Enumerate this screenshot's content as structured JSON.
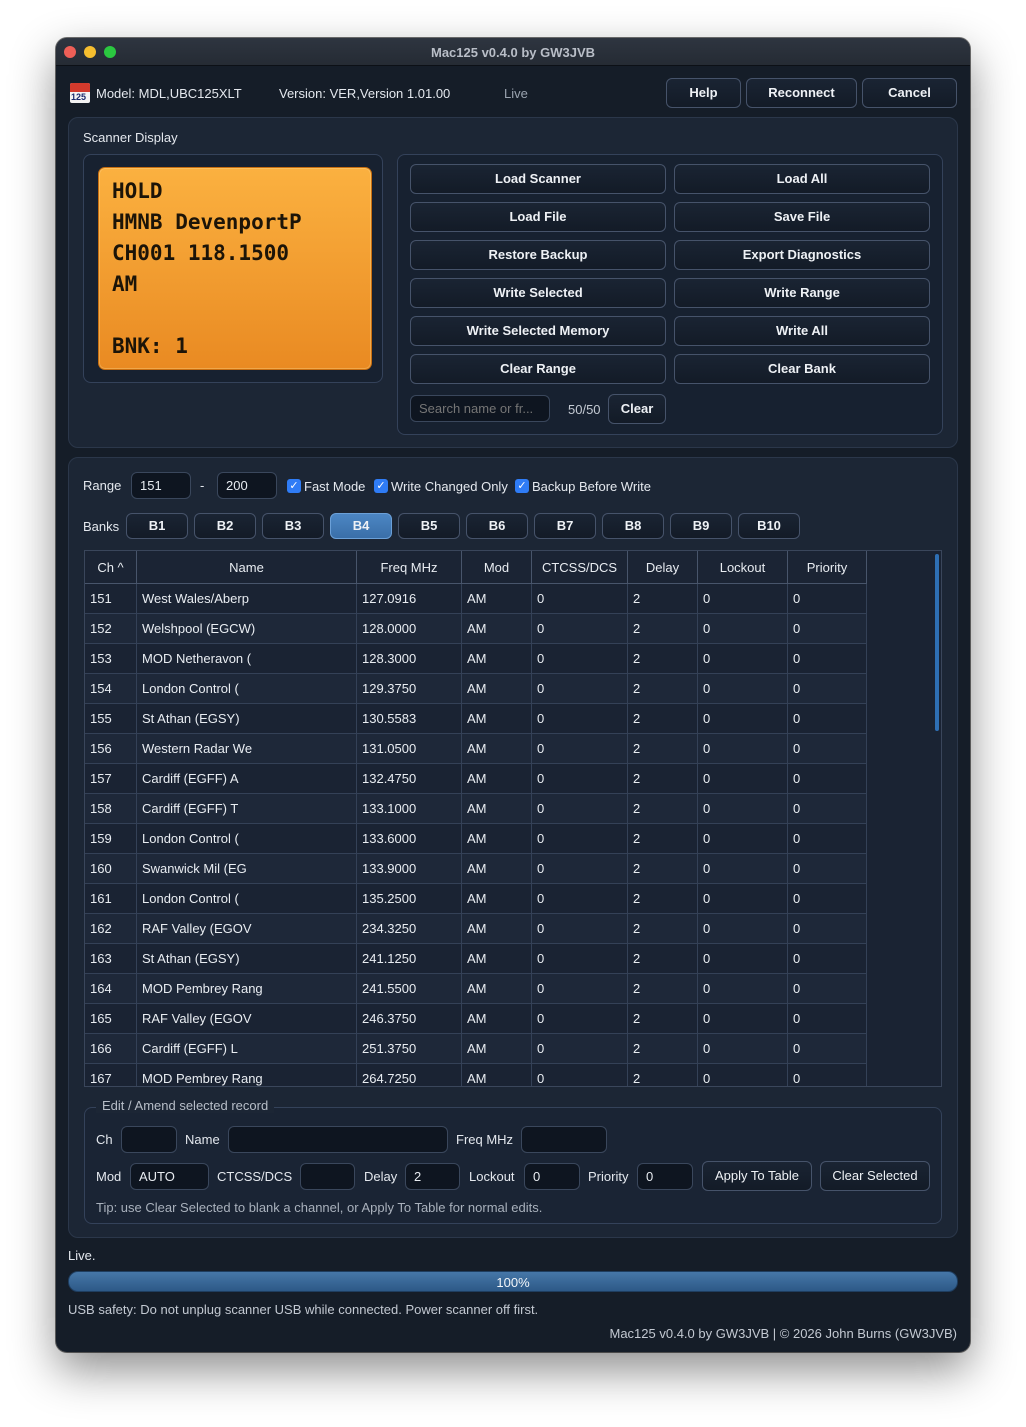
{
  "window": {
    "title": "Mac125 v0.4.0 by GW3JVB"
  },
  "header": {
    "model": "Model: MDL,UBC125XLT",
    "version": "Version: VER,Version 1.01.00",
    "status": "Live",
    "buttons": {
      "help": "Help",
      "reconnect": "Reconnect",
      "cancel": "Cancel"
    }
  },
  "scanner_display": {
    "title": "Scanner Display",
    "lines": [
      "HOLD",
      "HMNB DevenportP",
      "CH001 118.1500",
      "AM",
      "",
      "BNK: 1"
    ]
  },
  "actions": {
    "load_scanner": "Load Scanner",
    "load_all": "Load All",
    "load_file": "Load File",
    "save_file": "Save File",
    "restore_backup": "Restore Backup",
    "export_diagnostics": "Export Diagnostics",
    "write_selected": "Write Selected",
    "write_range": "Write Range",
    "write_selected_memory": "Write Selected Memory",
    "write_all": "Write All",
    "clear_range": "Clear Range",
    "clear_bank": "Clear Bank",
    "search_placeholder": "Search name or fr...",
    "search_count": "50/50",
    "search_clear": "Clear"
  },
  "range": {
    "label": "Range",
    "from": "151",
    "sep": "-",
    "to": "200",
    "fast_mode": "Fast Mode",
    "write_changed_only": "Write Changed Only",
    "backup_before_write": "Backup Before Write"
  },
  "banks": {
    "label": "Banks",
    "items": [
      "B1",
      "B2",
      "B3",
      "B4",
      "B5",
      "B6",
      "B7",
      "B8",
      "B9",
      "B10"
    ],
    "active": "B4"
  },
  "table": {
    "columns": [
      "Ch ^",
      "Name",
      "Freq MHz",
      "Mod",
      "CTCSS/DCS",
      "Delay",
      "Lockout",
      "Priority"
    ],
    "rows": [
      [
        "151",
        "West Wales/Aberp",
        "127.0916",
        "AM",
        "0",
        "2",
        "0",
        "0"
      ],
      [
        "152",
        "Welshpool (EGCW)",
        "128.0000",
        "AM",
        "0",
        "2",
        "0",
        "0"
      ],
      [
        "153",
        "MOD Netheravon (",
        "128.3000",
        "AM",
        "0",
        "2",
        "0",
        "0"
      ],
      [
        "154",
        "London Control (",
        "129.3750",
        "AM",
        "0",
        "2",
        "0",
        "0"
      ],
      [
        "155",
        "St Athan (EGSY)",
        "130.5583",
        "AM",
        "0",
        "2",
        "0",
        "0"
      ],
      [
        "156",
        "Western Radar We",
        "131.0500",
        "AM",
        "0",
        "2",
        "0",
        "0"
      ],
      [
        "157",
        "Cardiff (EGFF) A",
        "132.4750",
        "AM",
        "0",
        "2",
        "0",
        "0"
      ],
      [
        "158",
        "Cardiff (EGFF) T",
        "133.1000",
        "AM",
        "0",
        "2",
        "0",
        "0"
      ],
      [
        "159",
        "London Control (",
        "133.6000",
        "AM",
        "0",
        "2",
        "0",
        "0"
      ],
      [
        "160",
        "Swanwick Mil (EG",
        "133.9000",
        "AM",
        "0",
        "2",
        "0",
        "0"
      ],
      [
        "161",
        "London Control (",
        "135.2500",
        "AM",
        "0",
        "2",
        "0",
        "0"
      ],
      [
        "162",
        "RAF Valley (EGOV",
        "234.3250",
        "AM",
        "0",
        "2",
        "0",
        "0"
      ],
      [
        "163",
        "St Athan (EGSY)",
        "241.1250",
        "AM",
        "0",
        "2",
        "0",
        "0"
      ],
      [
        "164",
        "MOD Pembrey Rang",
        "241.5500",
        "AM",
        "0",
        "2",
        "0",
        "0"
      ],
      [
        "165",
        "RAF Valley (EGOV",
        "246.3750",
        "AM",
        "0",
        "2",
        "0",
        "0"
      ],
      [
        "166",
        "Cardiff (EGFF) L",
        "251.3750",
        "AM",
        "0",
        "2",
        "0",
        "0"
      ],
      [
        "167",
        "MOD Pembrey Rang",
        "264.7250",
        "AM",
        "0",
        "2",
        "0",
        "0"
      ]
    ]
  },
  "edit": {
    "legend": "Edit / Amend selected record",
    "ch_label": "Ch",
    "ch_value": "",
    "name_label": "Name",
    "name_value": "",
    "freq_label": "Freq MHz",
    "freq_value": "",
    "mod_label": "Mod",
    "mod_value": "AUTO",
    "ctcss_label": "CTCSS/DCS",
    "ctcss_value": "",
    "delay_label": "Delay",
    "delay_value": "2",
    "lockout_label": "Lockout",
    "lockout_value": "0",
    "priority_label": "Priority",
    "priority_value": "0",
    "apply": "Apply To Table",
    "clear_selected": "Clear Selected",
    "tip": "Tip: use Clear Selected to blank a channel, or Apply To Table for normal edits."
  },
  "footer": {
    "status": "Live.",
    "progress_label": "100%",
    "progress_value": 1.0,
    "usb_safety": "USB safety: Do not unplug scanner USB while connected. Power scanner off first.",
    "credit": "Mac125 v0.4.0 by GW3JVB | © 2026 John Burns (GW3JVB)"
  },
  "icons": {
    "app_logo": "app-logo-icon",
    "checkbox": "checkmark-icon"
  },
  "colors": {
    "accent": "#2f7cf6",
    "lcd": "#f5a432",
    "active_tab": "#4a84c2",
    "progress": "#3f6e9e"
  }
}
